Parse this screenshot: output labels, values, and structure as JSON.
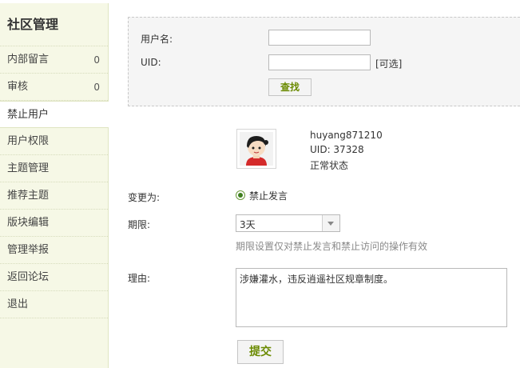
{
  "sidebar": {
    "title": "社区管理",
    "items": [
      {
        "label": "内部留言",
        "count": "0"
      },
      {
        "label": "审核",
        "count": "0"
      },
      {
        "label": "禁止用户",
        "count": ""
      },
      {
        "label": "用户权限",
        "count": ""
      },
      {
        "label": "主题管理",
        "count": ""
      },
      {
        "label": "推荐主题",
        "count": ""
      },
      {
        "label": "版块编辑",
        "count": ""
      },
      {
        "label": "管理举报",
        "count": ""
      },
      {
        "label": "返回论坛",
        "count": ""
      },
      {
        "label": "退出",
        "count": ""
      }
    ],
    "active_item": "禁止用户"
  },
  "search": {
    "username_label": "用户名:",
    "username_value": "",
    "uid_label": "UID:",
    "uid_value": "",
    "uid_optional": "[可选]",
    "search_button": "查找"
  },
  "user": {
    "avatar_icon": "user-avatar-cartoon-icon",
    "name": "huyang871210",
    "uid": "UID: 37328",
    "status": "正常状态"
  },
  "form": {
    "change_label": "变更为:",
    "change_option": "禁止发言",
    "change_selected": true,
    "period_label": "期限:",
    "period_value": "3天",
    "period_hint": "期限设置仅对禁止发言和禁止访问的操作有效",
    "reason_label": "理由:",
    "reason_value": "涉嫌灌水，违反逍遥社区规章制度。",
    "submit_button": "提交"
  },
  "colors": {
    "sidebar_bg": "#f6f8e6",
    "panel_bg": "#f5f5f5",
    "button_text": "#6a8a00"
  }
}
